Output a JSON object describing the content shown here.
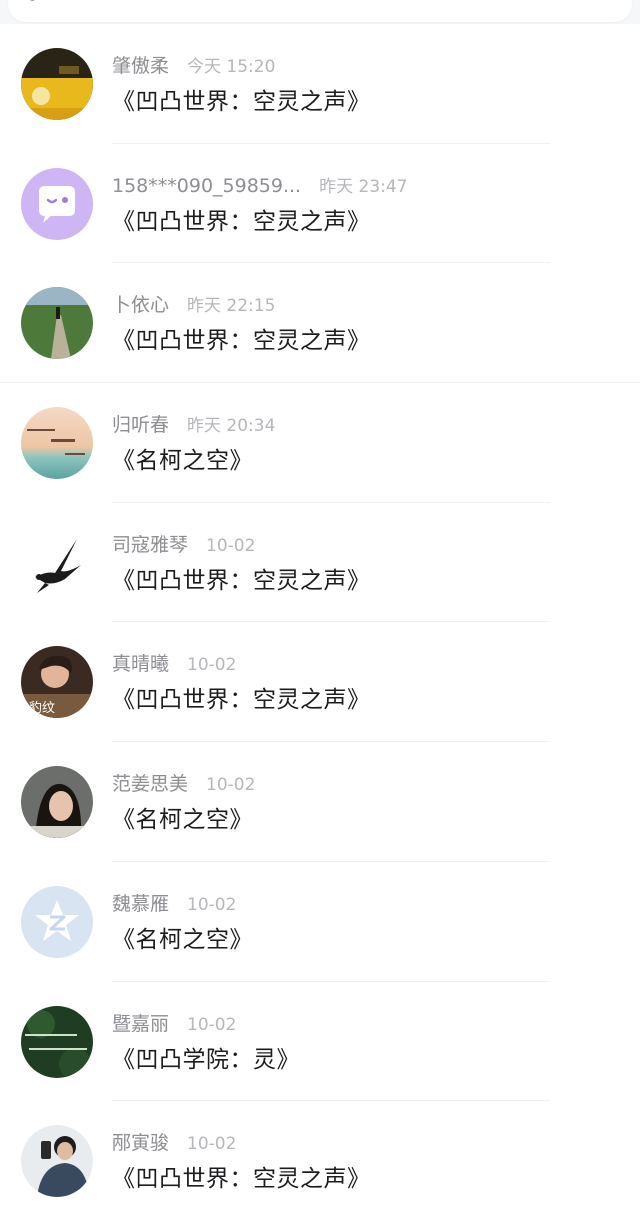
{
  "top_bar": {
    "search_icon": "search-icon"
  },
  "conversations": [
    {
      "name": "肇傲柔",
      "time": "今天 15:20",
      "message": "《凹凸世界：空灵之声》",
      "avatar": "photo-avatar-yellow-field"
    },
    {
      "name": "158***090_59859...",
      "time": "昨天 23:47",
      "message": "《凹凸世界：空灵之声》",
      "avatar": "chat-bubble-avatar"
    },
    {
      "name": "卜依心",
      "time": "昨天 22:15",
      "message": "《凹凸世界：空灵之声》",
      "avatar": "photo-avatar-green-path"
    },
    {
      "name": "归听春",
      "time": "昨天 20:34",
      "message": "《名柯之空》",
      "avatar": "photo-avatar-sunset-text"
    },
    {
      "name": "司寇雅琴",
      "time": "10-02",
      "message": "《凹凸世界：空灵之声》",
      "avatar": "swallow-bird-avatar"
    },
    {
      "name": "真晴曦",
      "time": "10-02",
      "message": "《凹凸世界：空灵之声》",
      "avatar": "photo-avatar-person-leopard"
    },
    {
      "name": "范姜思美",
      "time": "10-02",
      "message": "《名柯之空》",
      "avatar": "photo-avatar-woman"
    },
    {
      "name": "魏慕雁",
      "time": "10-02",
      "message": "《名柯之空》",
      "avatar": "default-star-avatar"
    },
    {
      "name": "暨嘉丽",
      "time": "10-02",
      "message": "《凹凸学院：灵》",
      "avatar": "photo-avatar-green-text"
    },
    {
      "name": "邴寅骏",
      "time": "10-02",
      "message": "《凹凸世界：空灵之声》",
      "avatar": "photo-avatar-man-phone"
    }
  ],
  "colors": {
    "name": "#8e8e93",
    "time": "#b6b6bb",
    "message": "#1c1c1e",
    "divider": "#f1f1f3",
    "chat_avatar_bg": "#cdb6f3",
    "star_avatar_bg": "#d9e4f3"
  },
  "avatar_caption_5": "豹纹"
}
